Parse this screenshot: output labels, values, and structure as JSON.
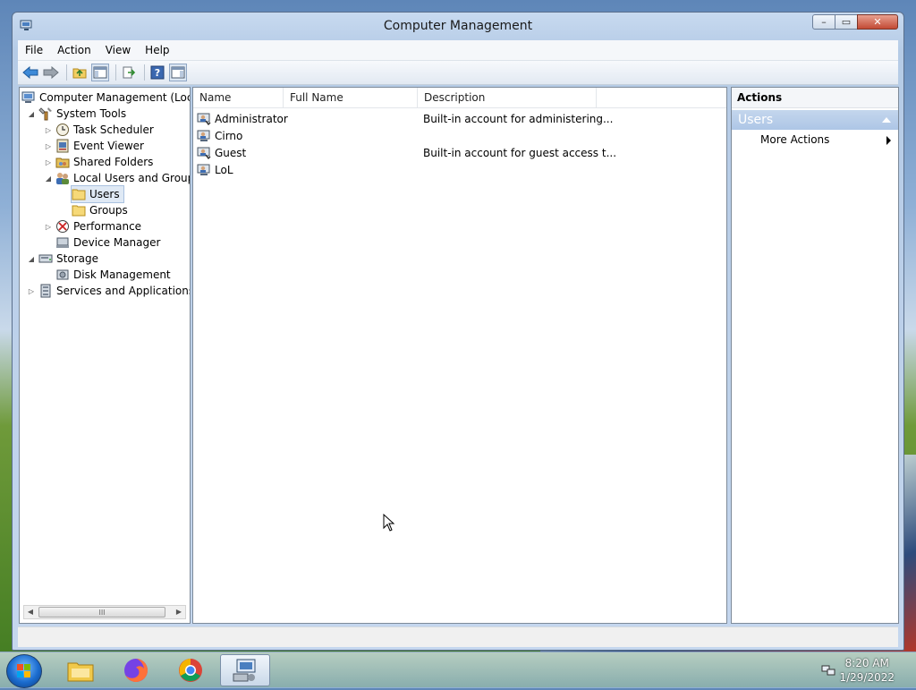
{
  "window": {
    "title": "Computer Management",
    "controls": {
      "minimize": "–",
      "restore": "▭",
      "close": "✕"
    }
  },
  "menu": [
    "File",
    "Action",
    "View",
    "Help"
  ],
  "toolbar_icons": [
    "back-arrow-icon",
    "forward-arrow-icon",
    "up-folder-icon",
    "show-hide-tree-icon",
    "export-list-icon",
    "help-icon",
    "show-hide-action-pane-icon"
  ],
  "tree": [
    {
      "label": "Computer Management (Local",
      "icon": "computer-management-icon",
      "twisty": ""
    },
    {
      "label": "System Tools",
      "icon": "system-tools-icon",
      "twisty": "◢"
    },
    {
      "label": "Task Scheduler",
      "icon": "clock-icon",
      "twisty": "▷"
    },
    {
      "label": "Event Viewer",
      "icon": "event-viewer-icon",
      "twisty": "▷"
    },
    {
      "label": "Shared Folders",
      "icon": "shared-folders-icon",
      "twisty": "▷"
    },
    {
      "label": "Local Users and Groups",
      "icon": "users-groups-icon",
      "twisty": "◢"
    },
    {
      "label": "Users",
      "icon": "folder-icon",
      "twisty": "",
      "selected": true
    },
    {
      "label": "Groups",
      "icon": "folder-icon",
      "twisty": ""
    },
    {
      "label": "Performance",
      "icon": "performance-icon",
      "twisty": "▷"
    },
    {
      "label": "Device Manager",
      "icon": "device-manager-icon",
      "twisty": ""
    },
    {
      "label": "Storage",
      "icon": "storage-icon",
      "twisty": "◢"
    },
    {
      "label": "Disk Management",
      "icon": "disk-management-icon",
      "twisty": ""
    },
    {
      "label": "Services and Applications",
      "icon": "services-icon",
      "twisty": "▷"
    }
  ],
  "tree_scroll": {
    "left": "◀",
    "right": "▶",
    "grip": "III"
  },
  "list": {
    "columns": [
      "Name",
      "Full Name",
      "Description"
    ],
    "rows": [
      {
        "name": "Administrator",
        "full_name": "",
        "description": "Built-in account for administering..."
      },
      {
        "name": "Cirno",
        "full_name": "",
        "description": ""
      },
      {
        "name": "Guest",
        "full_name": "",
        "description": "Built-in account for guest access t..."
      },
      {
        "name": "LoL",
        "full_name": "",
        "description": ""
      }
    ]
  },
  "actions": {
    "header": "Actions",
    "section": "Users",
    "items": [
      "More Actions"
    ]
  },
  "taskbar": {
    "apps": [
      "file-explorer-icon",
      "firefox-icon",
      "chrome-icon",
      "computer-management-app-icon"
    ],
    "time": "8:20 AM",
    "date": "1/29/2022"
  }
}
